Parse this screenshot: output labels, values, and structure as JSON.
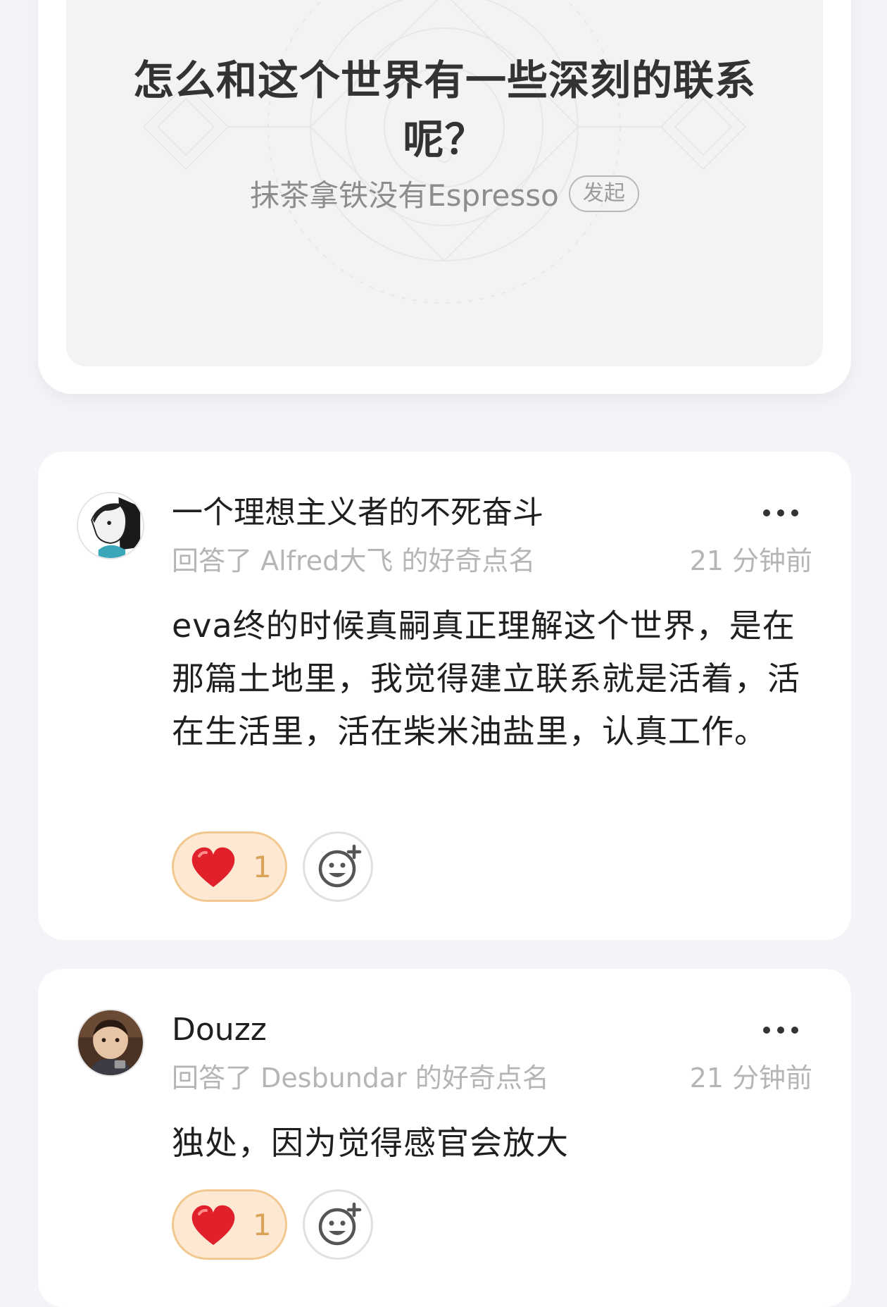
{
  "question": {
    "title": "怎么和这个世界有一些深刻的联系呢？",
    "author": "抹茶拿铁没有Espresso",
    "badge": "发起"
  },
  "answers": [
    {
      "author": "一个理想主义者的不死奋斗",
      "meta": "回答了 Alfred大飞 的好奇点名",
      "time": "21 分钟前",
      "body": "eva终的时候真嗣真正理解这个世界，是在那篇土地里，我觉得建立联系就是活着，活在生活里，活在柴米油盐里，认真工作。",
      "like_count": "1",
      "avatar_icon": "avatar-illustrated-man"
    },
    {
      "author": "Douzz",
      "meta": "回答了 Desbundar 的好奇点名",
      "time": "21 分钟前",
      "body": "独处，因为觉得感官会放大",
      "like_count": "1",
      "avatar_icon": "avatar-baby-photo"
    }
  ],
  "icons": {
    "more": "more-dots-icon",
    "like": "red-heart-icon",
    "react": "add-emoji-icon"
  },
  "colors": {
    "page_bg": "#f2f4f7",
    "card_bg": "#ffffff",
    "question_bg": "#f3f3f3",
    "like_pill_bg": "#fde9d3",
    "like_pill_border": "#f2c890",
    "heart": "#e0202a",
    "meta_text": "#b5b5b5"
  }
}
